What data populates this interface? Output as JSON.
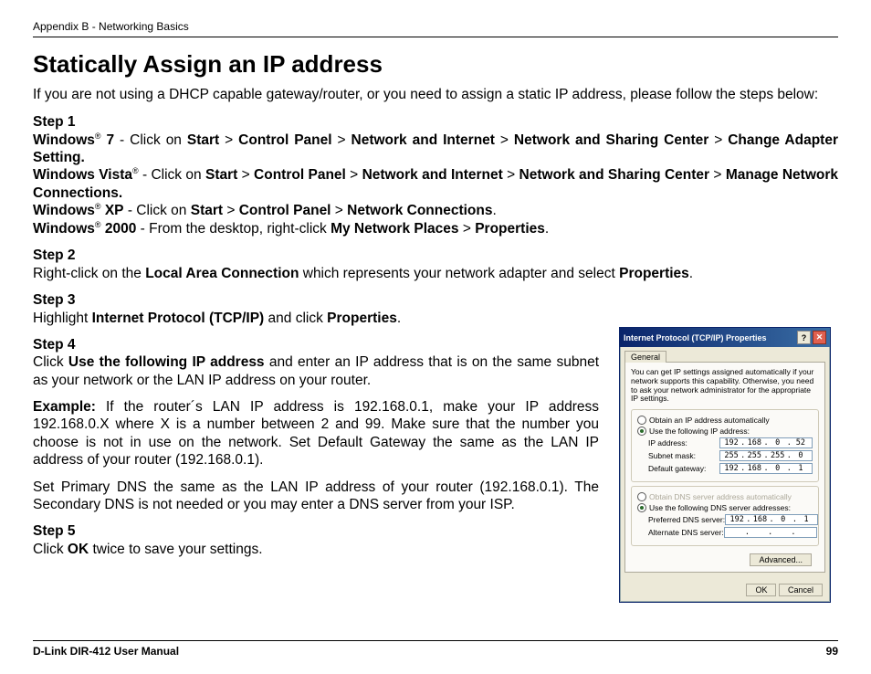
{
  "header": {
    "appendix": "Appendix B - Networking Basics"
  },
  "title": "Statically Assign an IP address",
  "intro": "If you are not using a DHCP capable gateway/router, or you need to assign a static IP address, please follow the steps below:",
  "steps": {
    "s1": {
      "heading": "Step 1",
      "w7_pre": "Windows",
      "w7_reg": "®",
      "w7_ver": " 7",
      "w7_txt": " - Click on ",
      "start": "Start",
      "gt": " > ",
      "cp": "Control Panel",
      "ni": "Network and Internet",
      "nsc": "Network and Sharing Center",
      "cas": "Change Adapter Setting.",
      "vista_pre": "Windows Vista",
      "vista_reg": "®",
      "vista_txt": " - Click on ",
      "mnc": "Manage Network Connections.",
      "xp_pre": "Windows",
      "xp_reg": "®",
      "xp_ver": " XP",
      "xp_txt": " - Click on ",
      "nc": "Network Connections",
      "w2k_pre": "Windows",
      "w2k_reg": "®",
      "w2k_ver": " 2000",
      "w2k_txt": " - From the desktop, right-click ",
      "mnp": "My Network Places",
      "props": "Properties"
    },
    "s2": {
      "heading": "Step 2",
      "pre": "Right-click on the ",
      "lac": "Local Area Connection",
      "mid": " which represents your network adapter and select ",
      "props": "Properties",
      "end": "."
    },
    "s3": {
      "heading": "Step 3",
      "pre": "Highlight ",
      "proto": "Internet Protocol (TCP/IP)",
      "mid": " and click ",
      "props": "Properties",
      "end": "."
    },
    "s4": {
      "heading": "Step 4",
      "pre": "Click ",
      "uf": "Use the following IP address",
      "post": " and enter an IP address that is on the same subnet as your network or the LAN IP address on your router."
    },
    "ex": {
      "lbl": "Example:",
      "txt": " If the router´s LAN IP address is 192.168.0.1, make your IP address 192.168.0.X where X is a number between 2 and 99. Make sure that the number you choose is not in use on the network. Set Default Gateway the same as the LAN IP address of your router (192.168.0.1)."
    },
    "dns": "Set Primary DNS the same as the LAN IP address of your router (192.168.0.1). The Secondary DNS is not needed or you may enter a DNS server from your ISP.",
    "s5": {
      "heading": "Step 5",
      "pre": "Click ",
      "ok": "OK",
      "post": " twice to save your settings."
    }
  },
  "footer": {
    "left": "D-Link DIR-412 User Manual",
    "page": "99"
  },
  "dialog": {
    "title": "Internet Protocol (TCP/IP) Properties",
    "tab": "General",
    "desc": "You can get IP settings assigned automatically if your network supports this capability. Otherwise, you need to ask your network administrator for the appropriate IP settings.",
    "r1": "Obtain an IP address automatically",
    "r2": "Use the following IP address:",
    "f_ip": "IP address:",
    "f_mask": "Subnet mask:",
    "f_gw": "Default gateway:",
    "r3": "Obtain DNS server address automatically",
    "r4": "Use the following DNS server addresses:",
    "f_pdns": "Preferred DNS server:",
    "f_adns": "Alternate DNS server:",
    "ip": [
      "192",
      "168",
      "0",
      "52"
    ],
    "mask": [
      "255",
      "255",
      "255",
      "0"
    ],
    "gw": [
      "192",
      "168",
      "0",
      "1"
    ],
    "pdns": [
      "192",
      "168",
      "0",
      "1"
    ],
    "adns": [
      ".",
      ".",
      ".",
      "."
    ],
    "adv": "Advanced...",
    "ok": "OK",
    "cancel": "Cancel"
  }
}
